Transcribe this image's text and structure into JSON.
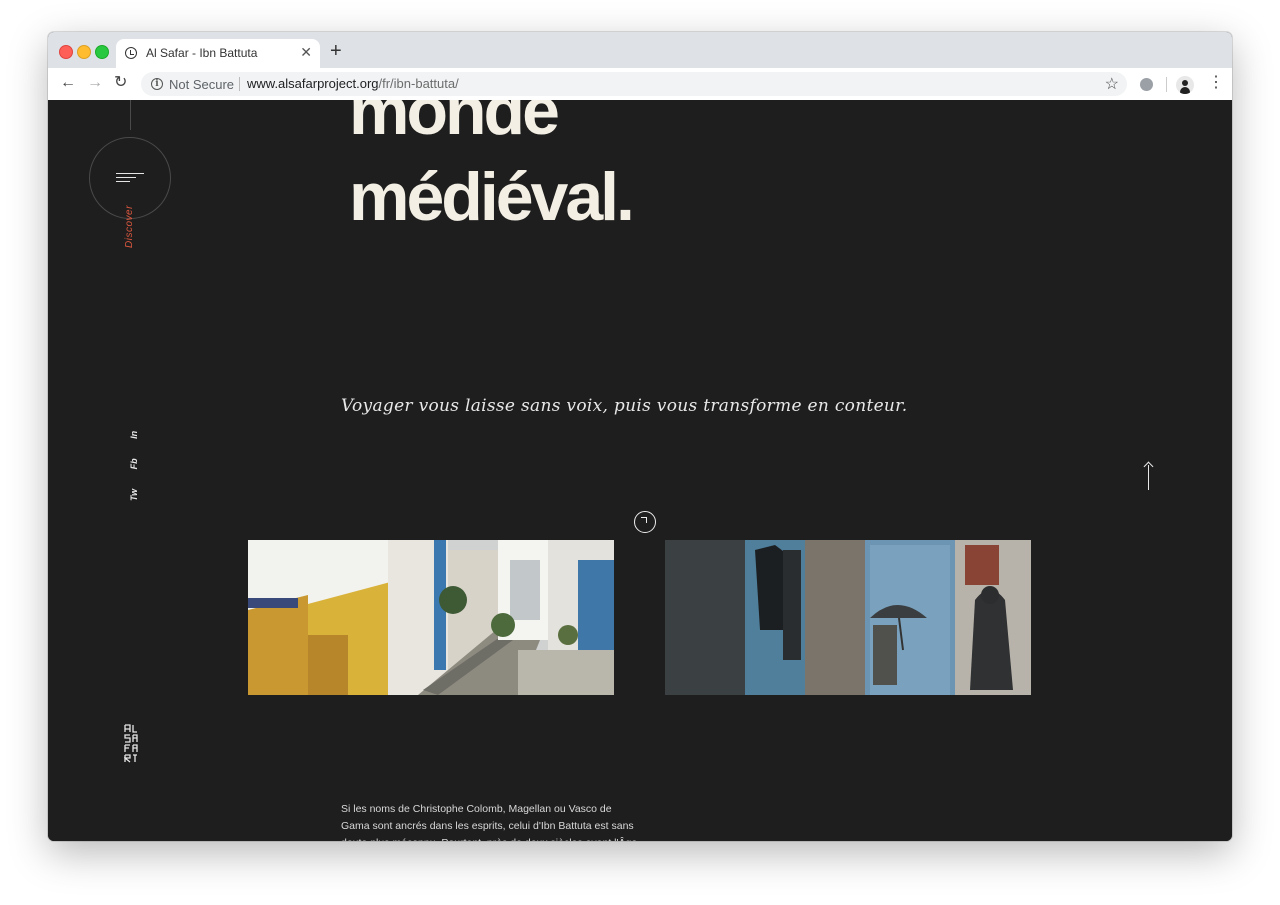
{
  "browser": {
    "tab_title": "Al Safar - Ibn Battuta",
    "new_tab_label": "+",
    "tab_close_label": "✕",
    "security_label": "Not Secure",
    "url_domain": "www.alsafarproject.org",
    "url_path": "/fr/ibn-battuta/",
    "back_glyph": "←",
    "forward_glyph": "→",
    "reload_glyph": "↻",
    "star_glyph": "☆",
    "menu_glyph": "⋮",
    "info_glyph": "i"
  },
  "sidebar": {
    "discover_label": "Discover",
    "social": [
      "Tw",
      "Fb",
      "In"
    ],
    "logo_lettering": "AL SAFAR"
  },
  "main": {
    "headline_lines": [
      "monde",
      "médiéval."
    ],
    "quote": "Voyager vous laisse sans voix, puis vous transforme en conteur.",
    "body_text": "Si les noms de Christophe Colomb, Magellan ou Vasco de Gama sont ancrés dans les esprits, celui d'Ibn Battuta est sans doute plus méconnu. Pourtant, près de deux siècles avant l'Âge des"
  },
  "colors": {
    "page_background": "#1e1e1e",
    "headline": "#f3efe4",
    "discover_accent": "#e0593f",
    "text_light": "#e8e8e8"
  },
  "icons": {
    "menu": "hamburger-icon",
    "scroll_top": "arrow-up-icon",
    "play": "play-circle-icon",
    "site_favicon": "clock-favicon-icon"
  }
}
